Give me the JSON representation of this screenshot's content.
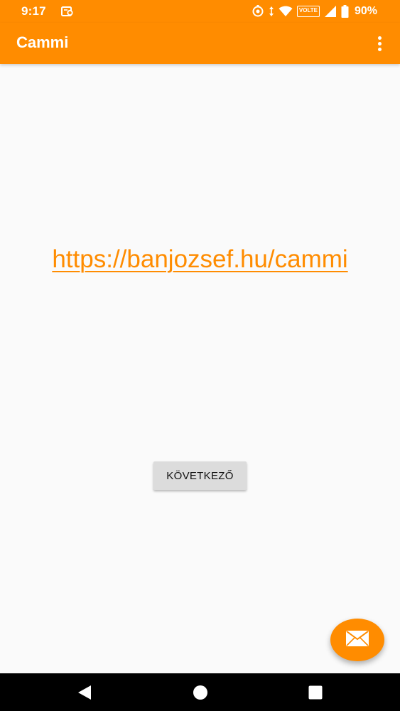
{
  "status_bar": {
    "time": "9:17",
    "network": "VOLTE",
    "battery": "90%",
    "icons": [
      "notification-icon",
      "sync-icon",
      "data-arrows-icon",
      "wifi-icon",
      "volte-icon",
      "signal-icon",
      "battery-icon"
    ]
  },
  "app_bar": {
    "title": "Cammi",
    "menu_icon": "more-vert-icon"
  },
  "content": {
    "link": "https://banjozsef.hu/cammi",
    "next_button": "KÖVETKEZŐ"
  },
  "fab": {
    "icon": "mail-icon"
  },
  "nav_bar": {
    "icons": [
      "back-icon",
      "home-icon",
      "recents-icon"
    ]
  },
  "colors": {
    "accent": "#ff8c00",
    "background": "#fafafa",
    "button": "#dcdcdc",
    "nav": "#000000"
  }
}
